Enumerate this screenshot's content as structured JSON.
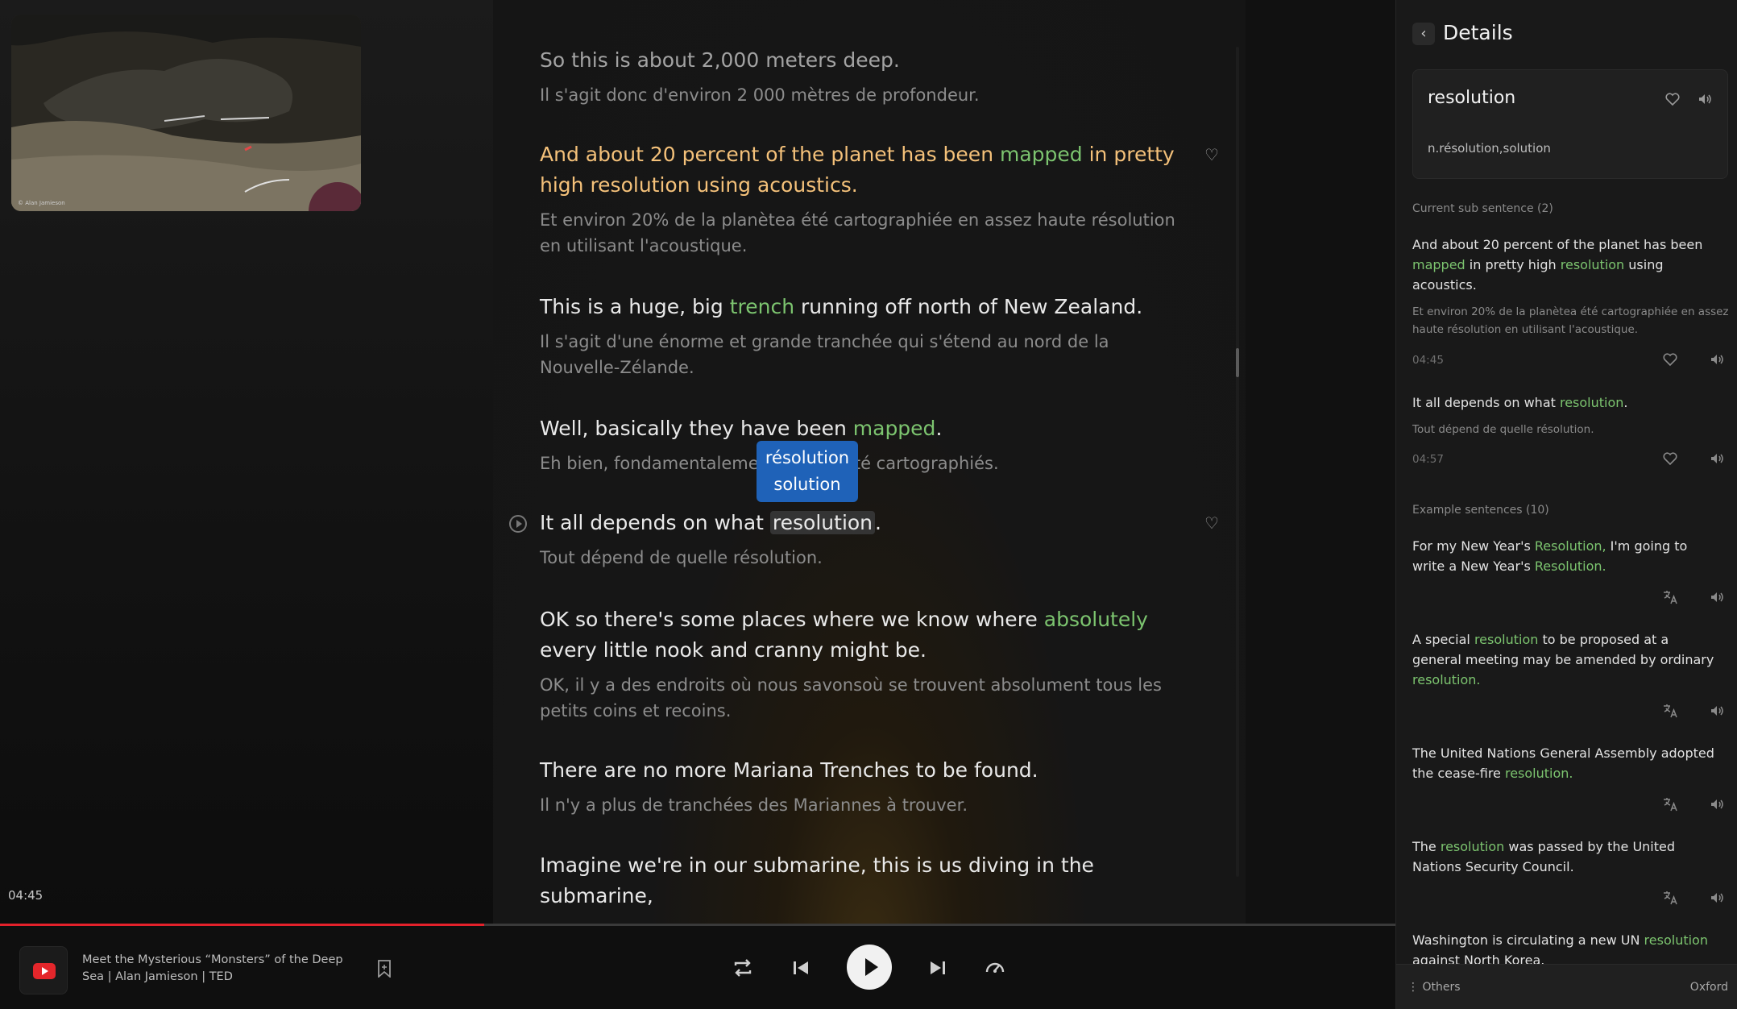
{
  "video": {
    "credit": "© Alan Jamieson",
    "elapsed": "04:45",
    "progress": 0.347
  },
  "transcript": {
    "s1": {
      "en": "So this is about 2,000 meters deep.",
      "fr": "Il s'agit donc d'environ 2 000 mètres de profondeur."
    },
    "s2": {
      "en_a": "And about 20 percent of the planet has been ",
      "hl1": "mapped",
      "en_b": " in pretty high resolution using acoustics.",
      "fr": "Et environ 20% de la planètea été cartographiée en assez haute résolution en utilisant l'acoustique."
    },
    "s3": {
      "en_a": "This is a huge, big ",
      "hl1": "trench",
      "en_b": " running off north of New Zealand.",
      "fr": "Il s'agit d'une énorme et grande tranchée qui s'étend au nord de la Nouvelle-Zélande."
    },
    "s4": {
      "en_a": "Well, basically they have been ",
      "hl1": "mapped",
      "en_b": ".",
      "fr": "Eh bien, fondamentalement, ils ont été cartographiés."
    },
    "s5": {
      "en_a": "It all depends on what ",
      "hl1": "resolution",
      "en_b": ".",
      "fr": "Tout dépend de quelle résolution."
    },
    "s6": {
      "en_a": "OK so there's some places where we know where ",
      "hl1": "absolutely",
      "en_b": " every little nook and cranny might be.",
      "fr": "OK, il y a des endroits où nous savonsoù se trouvent absolument tous les petits coins et recoins."
    },
    "s7": {
      "en": "There are no more Mariana Trenches to be found.",
      "fr": "Il n'y a plus de tranchées des Mariannes à trouver."
    },
    "s8": {
      "en": "Imagine we're in our submarine, this is us diving in the submarine,"
    },
    "tooltip": {
      "line1": "résolution",
      "line2": "solution"
    }
  },
  "player": {
    "title": "Meet the Mysterious “Monsters” of the Deep Sea | Alan Jamieson | TED",
    "icons": [
      "repeat-icon",
      "previous-icon",
      "play-icon",
      "next-icon",
      "speed-icon"
    ]
  },
  "details": {
    "title": "Details",
    "word": "resolution",
    "definition": "n.résolution,solution",
    "sub_label": "Current sub sentence (2)",
    "sub": [
      {
        "en_a": "And about 20 percent of the planet has been ",
        "hl1": "mapped",
        "en_b": " in pretty high ",
        "hl2": "resolution",
        "en_c": " using acoustics.",
        "fr": "Et environ 20% de la planètea été cartographiée en assez haute résolution en utilisant l'acoustique.",
        "time": "04:45"
      },
      {
        "en_a": "It all depends on what ",
        "hl1": "resolution",
        "en_b": ".",
        "fr": "Tout dépend de quelle résolution.",
        "time": "04:57"
      }
    ],
    "examples_label": "Example sentences (10)",
    "examples": [
      {
        "a": "For my New Year's ",
        "h1": "Resolution,",
        "b": " I'm going to write a New Year's ",
        "h2": "Resolution.",
        "c": ""
      },
      {
        "a": "A special ",
        "h1": "resolution",
        "b": " to be proposed at a general meeting may be amended by ordinary ",
        "h2": "resolution.",
        "c": ""
      },
      {
        "a": "The United Nations General Assembly adopted the cease-fire ",
        "h1": "resolution.",
        "b": "",
        "h2": "",
        "c": ""
      },
      {
        "a": "The ",
        "h1": "resolution",
        "b": " was passed by the United Nations Security Council.",
        "h2": "",
        "c": ""
      },
      {
        "a": "Washington is circulating a new UN ",
        "h1": "resolution",
        "b": " against North Korea.",
        "h2": "",
        "c": ""
      }
    ],
    "footer_others": "Others",
    "footer_source": "Oxford"
  },
  "colors": {
    "accent_green": "#7cc46f",
    "active_line": "#f4c17a",
    "progress_red": "#e3212b",
    "tooltip_blue": "#1f62b8"
  }
}
